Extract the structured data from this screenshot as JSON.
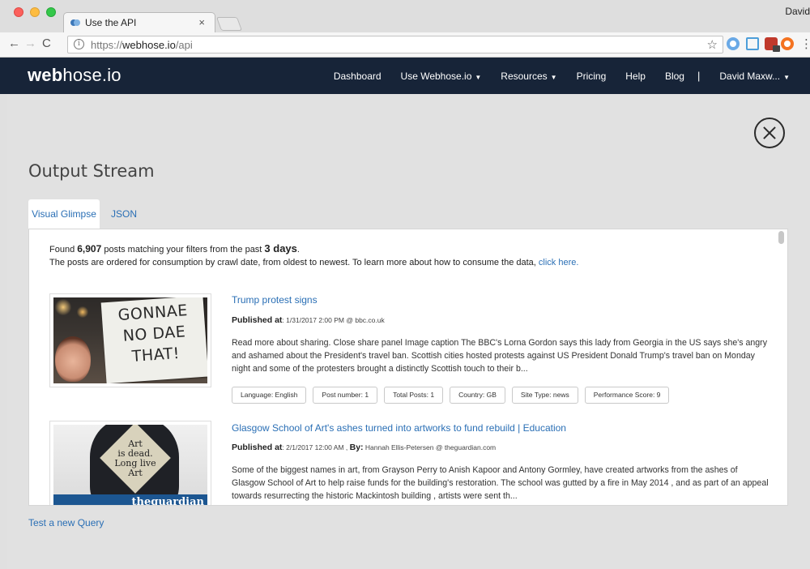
{
  "browser": {
    "tab_title": "Use the API",
    "tab_close": "×",
    "profile_name": "David",
    "url_prefix": "https://",
    "url_domain": "webhose.io",
    "url_path": "/api",
    "nav_back": "←",
    "nav_forward": "→",
    "nav_reload": "C",
    "info_glyph": "i",
    "star_glyph": "☆",
    "menu_glyph": "⋮"
  },
  "site": {
    "logo_bold": "web",
    "logo_rest": "hose.io",
    "nav": [
      {
        "label": "Dashboard",
        "caret": ""
      },
      {
        "label": "Use Webhose.io",
        "caret": "▼"
      },
      {
        "label": "Resources",
        "caret": "▼"
      },
      {
        "label": "Pricing",
        "caret": ""
      },
      {
        "label": "Help",
        "caret": ""
      },
      {
        "label": "Blog",
        "caret": ""
      }
    ],
    "nav_separator": "|",
    "user": {
      "label": "David Maxw...",
      "caret": "▼"
    }
  },
  "page": {
    "title": "Output Stream",
    "tabs": [
      "Visual Glimpse",
      "JSON"
    ],
    "summary": {
      "found_prefix": "Found ",
      "count": "6,907",
      "found_middle": " posts matching your filters from the past ",
      "days": "3 days",
      "found_suffix": ".",
      "ordered_text": "The posts are ordered for consumption by crawl date, from oldest to newest. To learn more about how to consume the data, ",
      "click_here": "click here."
    },
    "posts": [
      {
        "title": "Trump protest signs",
        "published_label": "Published at",
        "published_value": ": 1/31/2017 2:00 PM @ bbc.co.uk",
        "by_label": "",
        "by_value": "",
        "description": "Read more about sharing. Close share panel Image caption The BBC's Lorna Gordon says this lady from Georgia in the US says she's angry and ashamed about the President's travel ban. Scottish cities hosted protests against US President Donald Trump's travel ban on Monday night and some of the protesters brought a distinctly Scottish touch to their b...",
        "image_text": [
          "GONNAE",
          "NO DAE",
          "THAT!"
        ],
        "tags": [
          "Language: English",
          "Post number: 1",
          "Total Posts: 1",
          "Country: GB",
          "Site Type: news",
          "Performance Score: 9"
        ]
      },
      {
        "title": "Glasgow School of Art's ashes turned into artworks to fund rebuild | Education",
        "published_label": "Published at",
        "published_value": ": 2/1/2017 12:00 AM , ",
        "by_label": "By:",
        "by_value": " Hannah Ellis-Petersen @ theguardian.com",
        "description": "Some of the biggest names in art, from Grayson Perry to Anish Kapoor and Antony Gormley, have created artworks from the ashes of Glasgow School of Art to help raise funds for the building's restoration. The school was gutted by a fire in May 2014 , and as part of an appeal towards resurrecting the historic Mackintosh building , artists were sent th...",
        "image_text": [
          "Art",
          "is dead.",
          "Long live",
          "Art"
        ],
        "image_brand": "theguardian"
      }
    ],
    "test_query": "Test a new Query"
  }
}
